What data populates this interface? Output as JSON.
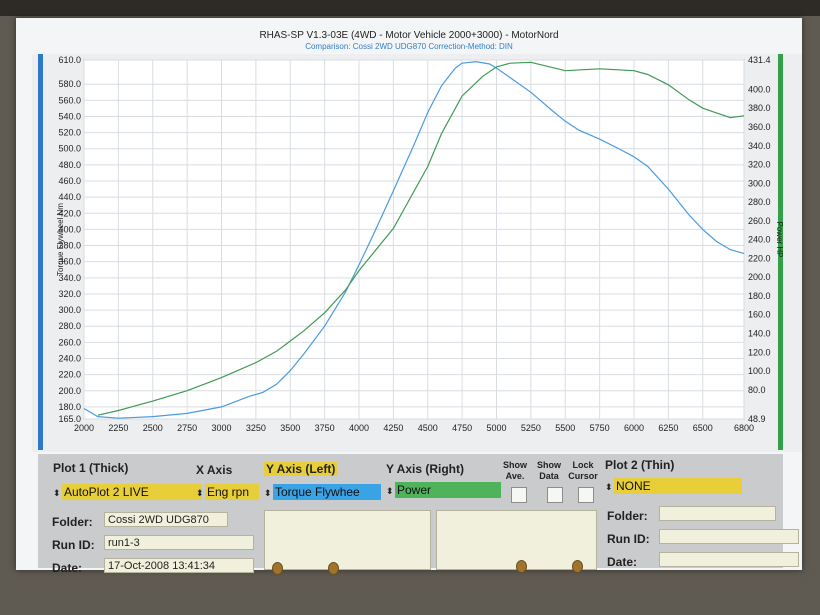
{
  "header": {
    "title": "RHAS-SP V1.3-03E  (4WD - Motor Vehicle 2000+3000) - MotorNord",
    "subtitle": "Comparison: Cossi 2WD UDG870    Correction-Method: DIN"
  },
  "colors": {
    "torque_line": "#4a9be0",
    "power_line": "#3f9a52",
    "left_bar": "#2d79c8",
    "right_bar": "#32a046",
    "yellow": "#e8cf3a",
    "blue": "#3aa3e6",
    "green": "#4fb35c"
  },
  "chart_data": {
    "type": "line",
    "xlabel": "",
    "ylabel": "Torque Flywheel Nm",
    "y2label": "Power HP",
    "xlim": [
      2000,
      6800
    ],
    "ylim": [
      165,
      610
    ],
    "y2lim": [
      48.9,
      431.4
    ],
    "x_ticks": [
      "2000",
      "2250",
      "2500",
      "2750",
      "3000",
      "3250",
      "3500",
      "3750",
      "4000",
      "4250",
      "4500",
      "4750",
      "5000",
      "5250",
      "5500",
      "5750",
      "6000",
      "6250",
      "6500",
      "6800"
    ],
    "y_ticks": [
      "610.0",
      "580.0",
      "560.0",
      "540.0",
      "520.0",
      "500.0",
      "480.0",
      "460.0",
      "440.0",
      "420.0",
      "400.0",
      "380.0",
      "360.0",
      "340.0",
      "320.0",
      "300.0",
      "280.0",
      "260.0",
      "240.0",
      "220.0",
      "200.0",
      "180.0",
      "165.0"
    ],
    "y2_ticks": [
      "431.4",
      "400.0",
      "380.0",
      "360.0",
      "340.0",
      "320.0",
      "300.0",
      "280.0",
      "260.0",
      "240.0",
      "220.0",
      "200.0",
      "180.0",
      "160.0",
      "140.0",
      "120.0",
      "100.0",
      "80.0",
      "48.9"
    ],
    "grid": true,
    "series": [
      {
        "axis": "left",
        "color": "#4a9be0",
        "x": [
          2000,
          2100,
          2250,
          2500,
          2750,
          3000,
          3200,
          3300,
          3400,
          3500,
          3600,
          3750,
          3900,
          4000,
          4100,
          4250,
          4400,
          4500,
          4600,
          4700,
          4750,
          4850,
          4950,
          5000,
          5100,
          5250,
          5400,
          5500,
          5600,
          5750,
          5900,
          6000,
          6100,
          6250,
          6400,
          6500,
          6600,
          6700,
          6800
        ],
        "y": [
          178,
          168,
          166,
          168,
          172,
          180,
          193,
          198,
          208,
          225,
          246,
          280,
          322,
          356,
          392,
          448,
          505,
          545,
          578,
          600,
          606,
          608,
          605,
          600,
          588,
          570,
          548,
          534,
          523,
          512,
          499,
          490,
          478,
          450,
          418,
          400,
          385,
          375,
          370
        ]
      },
      {
        "axis": "right",
        "color": "#3f9a52",
        "x": [
          2100,
          2250,
          2500,
          2750,
          3000,
          3250,
          3400,
          3500,
          3600,
          3750,
          3900,
          4000,
          4250,
          4500,
          4600,
          4750,
          4900,
          5000,
          5100,
          5250,
          5500,
          5750,
          6000,
          6100,
          6250,
          6400,
          6500,
          6600,
          6700,
          6800
        ],
        "y": [
          53,
          58,
          68,
          79,
          93,
          109,
          121,
          132,
          143,
          162,
          186,
          207,
          252,
          318,
          353,
          393,
          414,
          424,
          428,
          429,
          420,
          422,
          420,
          416,
          405,
          389,
          380,
          375,
          370,
          372
        ]
      }
    ]
  },
  "panel": {
    "plot1_label": "Plot 1 (Thick)",
    "xaxis_label": "X Axis",
    "yleft_label": "Y Axis (Left)",
    "yright_label": "Y Axis (Right)",
    "show_ave_label": "Show Ave.",
    "show_data_label": "Show Data",
    "lock_cursor_label": "Lock Cursor",
    "plot2_label": "Plot 2 (Thin)",
    "plot1_value": "AutoPlot 2 LIVE",
    "xaxis_value": "Eng rpn",
    "yleft_value": "Torque Flywhee",
    "yright_value": "Power",
    "plot2_value": "NONE",
    "folder_label": "Folder:",
    "folder_value": "Cossi 2WD UDG870",
    "runid_label": "Run ID:",
    "runid_value": "run1-3",
    "date_label": "Date:",
    "date_value": "17-Oct-2008  13:41:34",
    "folder2_label": "Folder:",
    "runid2_label": "Run ID:",
    "date2_label": "Date:"
  }
}
